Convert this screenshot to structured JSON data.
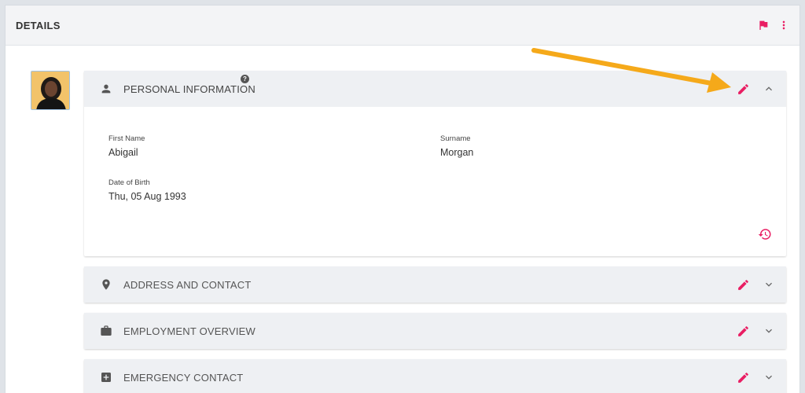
{
  "header": {
    "title": "DETAILS",
    "flag_icon": "flag-icon",
    "menu_icon": "more-vert-icon"
  },
  "colors": {
    "accent": "#e91e63",
    "arrow": "#f5a91a"
  },
  "sections": [
    {
      "title": "PERSONAL INFORMATION",
      "icon": "person-icon",
      "expanded": true,
      "fields": [
        {
          "label": "First Name",
          "value": "Abigail"
        },
        {
          "label": "Surname",
          "value": "Morgan"
        },
        {
          "label": "Date of Birth",
          "value": "Thu, 05 Aug 1993"
        }
      ]
    },
    {
      "title": "ADDRESS AND CONTACT",
      "icon": "location-pin-icon",
      "expanded": false
    },
    {
      "title": "EMPLOYMENT OVERVIEW",
      "icon": "briefcase-icon",
      "expanded": false
    },
    {
      "title": "EMERGENCY CONTACT",
      "icon": "medical-cross-icon",
      "expanded": false
    }
  ]
}
